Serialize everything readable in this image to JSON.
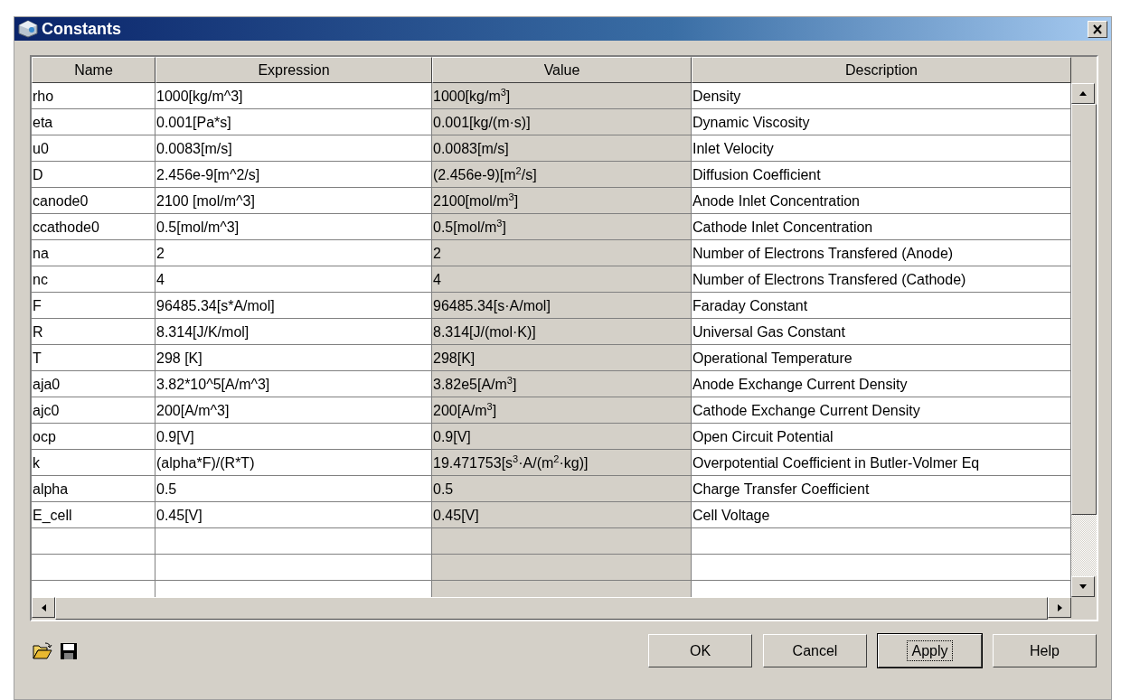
{
  "window": {
    "title": "Constants"
  },
  "table": {
    "columns": [
      "Name",
      "Expression",
      "Value",
      "Description"
    ],
    "rows": [
      {
        "name": "rho",
        "expression": "1000[kg/m^3]",
        "value": "1000[kg/m$^{3}$]",
        "description": "Density"
      },
      {
        "name": "eta",
        "expression": "0.001[Pa*s]",
        "value": "0.001[kg/(m·s)]",
        "description": "Dynamic Viscosity"
      },
      {
        "name": "u0",
        "expression": "0.0083[m/s]",
        "value": "0.0083[m/s]",
        "description": "Inlet Velocity"
      },
      {
        "name": "D",
        "expression": "2.456e-9[m^2/s]",
        "value": "(2.456e-9)[m$^{2}$/s]",
        "description": "Diffusion Coefficient"
      },
      {
        "name": "canode0",
        "expression": "2100 [mol/m^3]",
        "value": "2100[mol/m$^{3}$]",
        "description": "Anode Inlet Concentration"
      },
      {
        "name": "ccathode0",
        "expression": "0.5[mol/m^3]",
        "value": "0.5[mol/m$^{3}$]",
        "description": "Cathode Inlet Concentration"
      },
      {
        "name": "na",
        "expression": "2",
        "value": "2",
        "description": "Number of Electrons Transfered (Anode)"
      },
      {
        "name": "nc",
        "expression": "4",
        "value": "4",
        "description": "Number of Electrons Transfered (Cathode)"
      },
      {
        "name": "F",
        "expression": "96485.34[s*A/mol]",
        "value": "96485.34[s·A/mol]",
        "description": "Faraday Constant"
      },
      {
        "name": "R",
        "expression": "8.314[J/K/mol]",
        "value": "8.314[J/(mol·K)]",
        "description": "Universal Gas Constant"
      },
      {
        "name": "T",
        "expression": "298 [K]",
        "value": "298[K]",
        "description": "Operational Temperature"
      },
      {
        "name": "aja0",
        "expression": "3.82*10^5[A/m^3]",
        "value": "3.82e5[A/m$^{3}$]",
        "description": "Anode Exchange Current Density"
      },
      {
        "name": "ajc0",
        "expression": "200[A/m^3]",
        "value": "200[A/m$^{3}$]",
        "description": "Cathode Exchange Current Density"
      },
      {
        "name": "ocp",
        "expression": "0.9[V]",
        "value": "0.9[V]",
        "description": "Open Circuit Potential"
      },
      {
        "name": "k",
        "expression": "(alpha*F)/(R*T)",
        "value": "19.471753[s$^{3}$·A/(m$^{2}$·kg)]",
        "description": "Overpotential Coefficient in Butler-Volmer Eq"
      },
      {
        "name": "alpha",
        "expression": "0.5",
        "value": "0.5",
        "description": "Charge Transfer Coefficient"
      },
      {
        "name": "E_cell",
        "expression": "0.45[V]",
        "value": "0.45[V]",
        "description": "Cell Voltage"
      }
    ]
  },
  "buttons": [
    {
      "label": "OK",
      "focused": false
    },
    {
      "label": "Cancel",
      "focused": false
    },
    {
      "label": "Apply",
      "focused": true
    },
    {
      "label": "Help",
      "focused": false
    }
  ]
}
